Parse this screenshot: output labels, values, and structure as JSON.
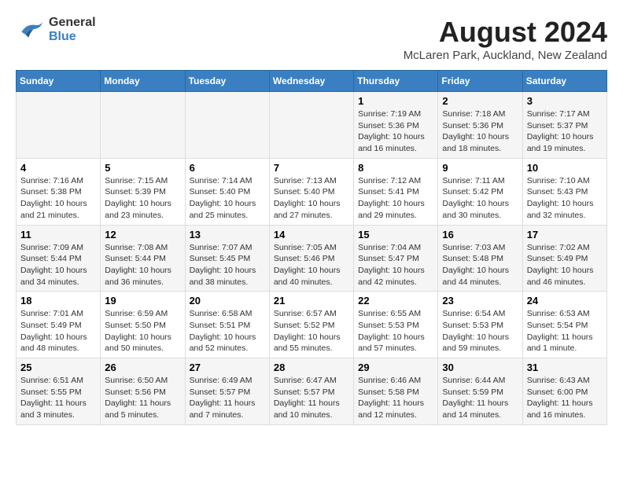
{
  "header": {
    "logo_line1": "General",
    "logo_line2": "Blue",
    "main_title": "August 2024",
    "subtitle": "McLaren Park, Auckland, New Zealand"
  },
  "days_of_week": [
    "Sunday",
    "Monday",
    "Tuesday",
    "Wednesday",
    "Thursday",
    "Friday",
    "Saturday"
  ],
  "weeks": [
    [
      {
        "day": "",
        "info": ""
      },
      {
        "day": "",
        "info": ""
      },
      {
        "day": "",
        "info": ""
      },
      {
        "day": "",
        "info": ""
      },
      {
        "day": "1",
        "info": "Sunrise: 7:19 AM\nSunset: 5:36 PM\nDaylight: 10 hours\nand 16 minutes."
      },
      {
        "day": "2",
        "info": "Sunrise: 7:18 AM\nSunset: 5:36 PM\nDaylight: 10 hours\nand 18 minutes."
      },
      {
        "day": "3",
        "info": "Sunrise: 7:17 AM\nSunset: 5:37 PM\nDaylight: 10 hours\nand 19 minutes."
      }
    ],
    [
      {
        "day": "4",
        "info": "Sunrise: 7:16 AM\nSunset: 5:38 PM\nDaylight: 10 hours\nand 21 minutes."
      },
      {
        "day": "5",
        "info": "Sunrise: 7:15 AM\nSunset: 5:39 PM\nDaylight: 10 hours\nand 23 minutes."
      },
      {
        "day": "6",
        "info": "Sunrise: 7:14 AM\nSunset: 5:40 PM\nDaylight: 10 hours\nand 25 minutes."
      },
      {
        "day": "7",
        "info": "Sunrise: 7:13 AM\nSunset: 5:40 PM\nDaylight: 10 hours\nand 27 minutes."
      },
      {
        "day": "8",
        "info": "Sunrise: 7:12 AM\nSunset: 5:41 PM\nDaylight: 10 hours\nand 29 minutes."
      },
      {
        "day": "9",
        "info": "Sunrise: 7:11 AM\nSunset: 5:42 PM\nDaylight: 10 hours\nand 30 minutes."
      },
      {
        "day": "10",
        "info": "Sunrise: 7:10 AM\nSunset: 5:43 PM\nDaylight: 10 hours\nand 32 minutes."
      }
    ],
    [
      {
        "day": "11",
        "info": "Sunrise: 7:09 AM\nSunset: 5:44 PM\nDaylight: 10 hours\nand 34 minutes."
      },
      {
        "day": "12",
        "info": "Sunrise: 7:08 AM\nSunset: 5:44 PM\nDaylight: 10 hours\nand 36 minutes."
      },
      {
        "day": "13",
        "info": "Sunrise: 7:07 AM\nSunset: 5:45 PM\nDaylight: 10 hours\nand 38 minutes."
      },
      {
        "day": "14",
        "info": "Sunrise: 7:05 AM\nSunset: 5:46 PM\nDaylight: 10 hours\nand 40 minutes."
      },
      {
        "day": "15",
        "info": "Sunrise: 7:04 AM\nSunset: 5:47 PM\nDaylight: 10 hours\nand 42 minutes."
      },
      {
        "day": "16",
        "info": "Sunrise: 7:03 AM\nSunset: 5:48 PM\nDaylight: 10 hours\nand 44 minutes."
      },
      {
        "day": "17",
        "info": "Sunrise: 7:02 AM\nSunset: 5:49 PM\nDaylight: 10 hours\nand 46 minutes."
      }
    ],
    [
      {
        "day": "18",
        "info": "Sunrise: 7:01 AM\nSunset: 5:49 PM\nDaylight: 10 hours\nand 48 minutes."
      },
      {
        "day": "19",
        "info": "Sunrise: 6:59 AM\nSunset: 5:50 PM\nDaylight: 10 hours\nand 50 minutes."
      },
      {
        "day": "20",
        "info": "Sunrise: 6:58 AM\nSunset: 5:51 PM\nDaylight: 10 hours\nand 52 minutes."
      },
      {
        "day": "21",
        "info": "Sunrise: 6:57 AM\nSunset: 5:52 PM\nDaylight: 10 hours\nand 55 minutes."
      },
      {
        "day": "22",
        "info": "Sunrise: 6:55 AM\nSunset: 5:53 PM\nDaylight: 10 hours\nand 57 minutes."
      },
      {
        "day": "23",
        "info": "Sunrise: 6:54 AM\nSunset: 5:53 PM\nDaylight: 10 hours\nand 59 minutes."
      },
      {
        "day": "24",
        "info": "Sunrise: 6:53 AM\nSunset: 5:54 PM\nDaylight: 11 hours\nand 1 minute."
      }
    ],
    [
      {
        "day": "25",
        "info": "Sunrise: 6:51 AM\nSunset: 5:55 PM\nDaylight: 11 hours\nand 3 minutes."
      },
      {
        "day": "26",
        "info": "Sunrise: 6:50 AM\nSunset: 5:56 PM\nDaylight: 11 hours\nand 5 minutes."
      },
      {
        "day": "27",
        "info": "Sunrise: 6:49 AM\nSunset: 5:57 PM\nDaylight: 11 hours\nand 7 minutes."
      },
      {
        "day": "28",
        "info": "Sunrise: 6:47 AM\nSunset: 5:57 PM\nDaylight: 11 hours\nand 10 minutes."
      },
      {
        "day": "29",
        "info": "Sunrise: 6:46 AM\nSunset: 5:58 PM\nDaylight: 11 hours\nand 12 minutes."
      },
      {
        "day": "30",
        "info": "Sunrise: 6:44 AM\nSunset: 5:59 PM\nDaylight: 11 hours\nand 14 minutes."
      },
      {
        "day": "31",
        "info": "Sunrise: 6:43 AM\nSunset: 6:00 PM\nDaylight: 11 hours\nand 16 minutes."
      }
    ]
  ]
}
